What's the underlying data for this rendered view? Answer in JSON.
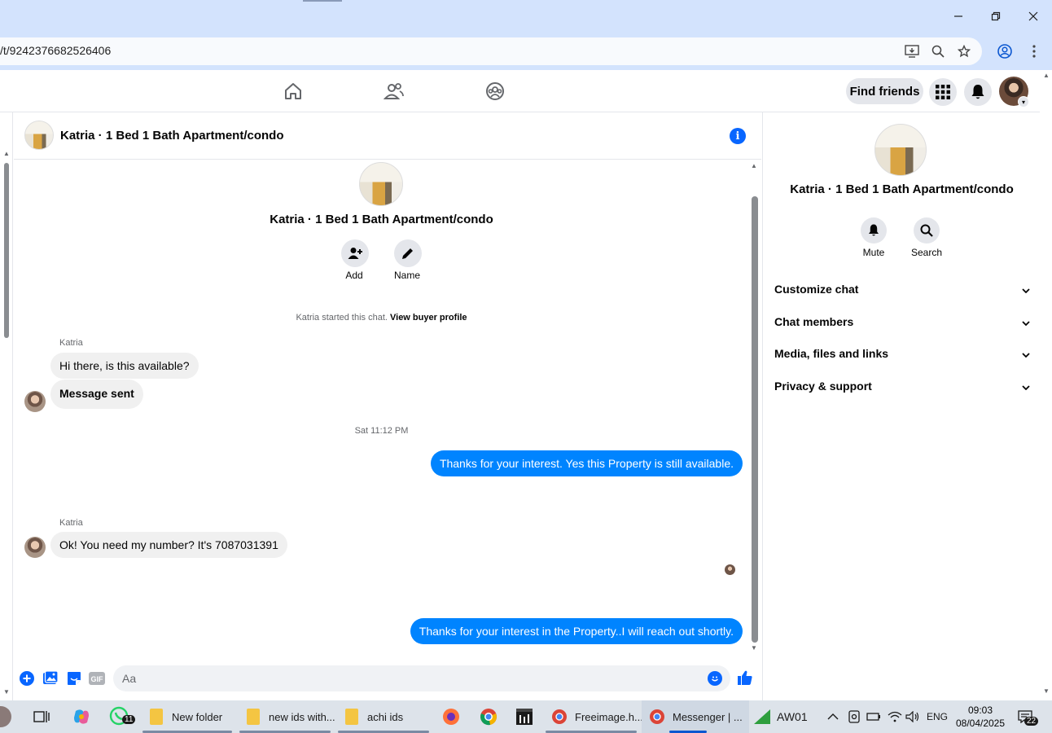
{
  "browser": {
    "url": "/t/9242376682526406",
    "window_controls": [
      "minimize",
      "restore",
      "close"
    ]
  },
  "fb_nav": {
    "find_friends_label": "Find friends"
  },
  "chat": {
    "title": "Katria · 1 Bed 1 Bath Apartment/condo",
    "intro": {
      "title": "Katria · 1 Bed 1 Bath Apartment/condo",
      "add_label": "Add",
      "name_label": "Name",
      "system_text": "Katria started this chat.",
      "system_link": "View buyer profile"
    },
    "messages": [
      {
        "sender": "Katria",
        "text": "Hi there, is this available?",
        "direction": "in"
      },
      {
        "text": "Message sent",
        "direction": "in"
      },
      {
        "timestamp": "Sat 11:12 PM"
      },
      {
        "text": "Thanks for your interest. Yes this Property is still available.",
        "direction": "out"
      },
      {
        "sender": "Katria",
        "text": "Ok! You need my number? It's 7087031391",
        "direction": "in"
      },
      {
        "text": "Thanks for your interest in the Property..I will reach  out shortly.",
        "direction": "out"
      }
    ],
    "composer_placeholder": "Aa"
  },
  "right_panel": {
    "title": "Katria · 1 Bed 1 Bath Apartment/condo",
    "mute_label": "Mute",
    "search_label": "Search",
    "sections": [
      "Customize chat",
      "Chat members",
      "Media, files and links",
      "Privacy & support"
    ]
  },
  "taskbar": {
    "items": [
      {
        "label": "New folder"
      },
      {
        "label": "new ids with..."
      },
      {
        "label": "achi ids"
      },
      {
        "label": "Freeimage.h..."
      },
      {
        "label": "Messenger | ..."
      },
      {
        "label": "AW01"
      }
    ],
    "whatsapp_badge": "11",
    "language": "ENG",
    "time": "09:03",
    "date": "08/04/2025",
    "notification_count": "22"
  },
  "colors": {
    "accent": "#0866ff",
    "outgoing_bubble": "#0084ff",
    "incoming_bubble": "#f0f0f0",
    "chrome_bg": "#d3e3fd"
  }
}
